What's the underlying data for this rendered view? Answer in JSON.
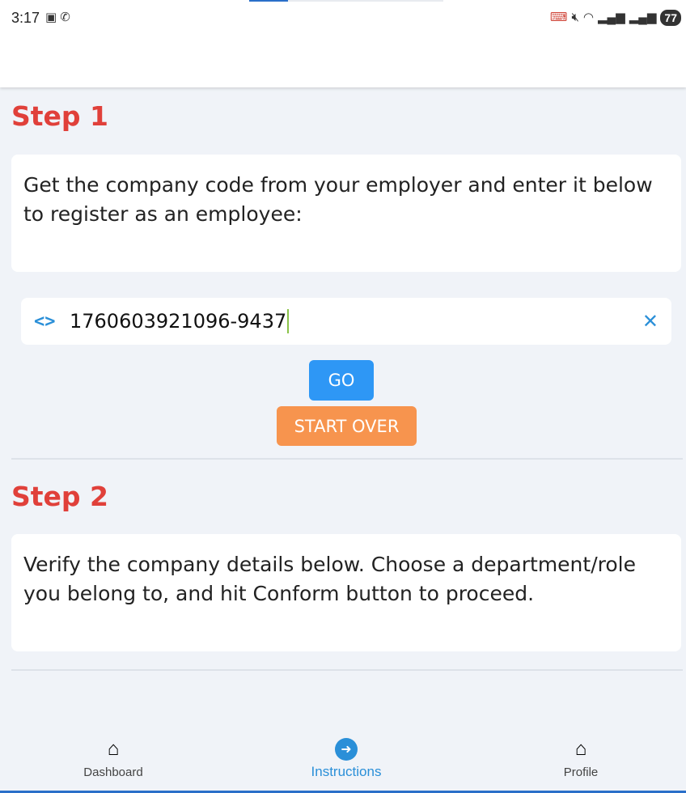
{
  "status_bar": {
    "time": "3:17",
    "battery": "77",
    "left_icons": [
      "screenshot-icon",
      "whatsapp-icon"
    ],
    "right_icons": [
      "cast-icon",
      "mute-icon",
      "wifi-icon",
      "signal-icon",
      "signal-icon"
    ]
  },
  "progress": {
    "fraction": 0.2
  },
  "step1": {
    "title": "Step 1",
    "instructions": "Get the company code from your employer and enter it below to register as an employee:",
    "code_input": {
      "value": "1760603921096-9437",
      "icon": "code-icon"
    },
    "go_label": "GO",
    "start_over_label": "START OVER"
  },
  "step2": {
    "title": "Step 2",
    "instructions": "Verify the company details below. Choose a department/role you belong to, and hit Conform button to proceed."
  },
  "colors": {
    "accent": "#2a8fd8",
    "step_title": "#e0403a",
    "go_button": "#2e97f5",
    "start_over_button": "#f7944e"
  },
  "bottom_nav": {
    "items": [
      {
        "label": "Dashboard",
        "icon": "home-icon"
      },
      {
        "label": "Instructions",
        "icon": "directions-icon",
        "active": true
      },
      {
        "label": "Profile",
        "icon": "home-icon"
      }
    ]
  }
}
